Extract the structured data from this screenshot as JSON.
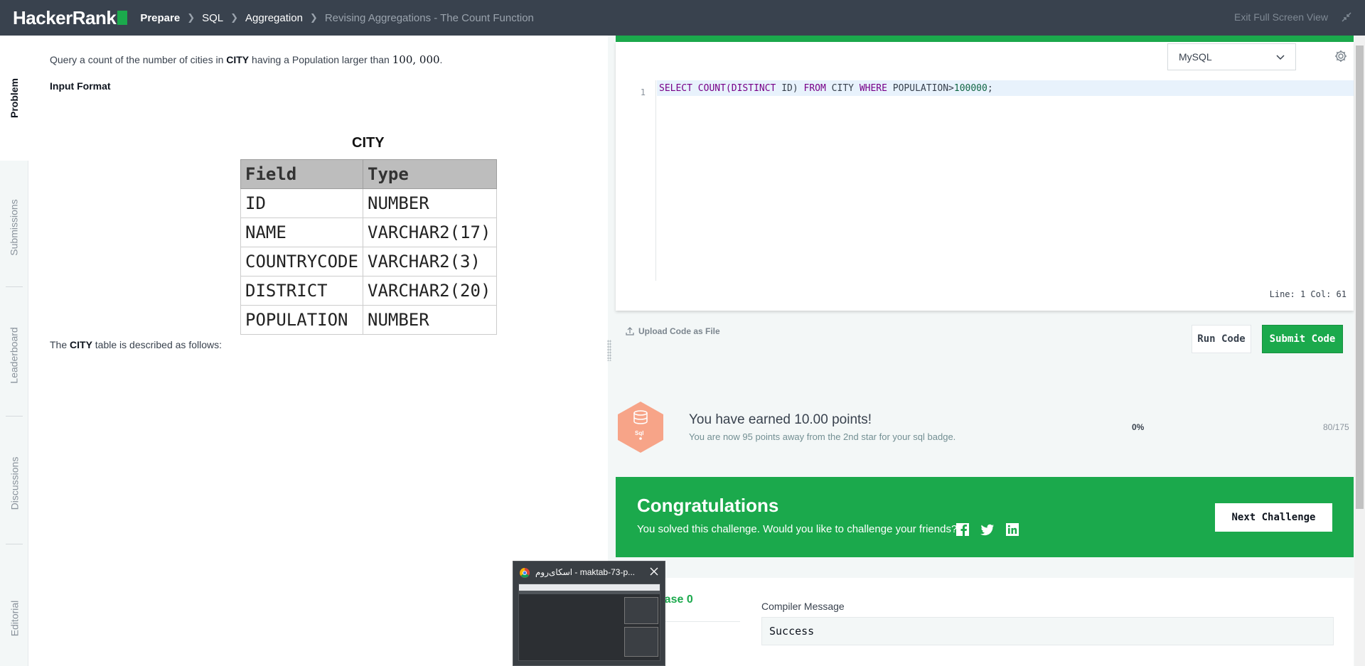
{
  "nav": {
    "logo_text": "HackerRank",
    "breadcrumbs": [
      "Prepare",
      "SQL",
      "Aggregation",
      "Revising Aggregations - The Count Function"
    ],
    "exit_label": "Exit Full Screen View"
  },
  "side_tabs": [
    "Problem",
    "Submissions",
    "Leaderboard",
    "Discussions",
    "Editorial"
  ],
  "problem": {
    "statement_pre": "Query a count of the number of cities in ",
    "statement_bold": "CITY",
    "statement_mid": " having a Population larger than ",
    "statement_math": "100, 000",
    "statement_end": ".",
    "input_format_label": "Input Format",
    "table_title": "CITY",
    "table_headers": [
      "Field",
      "Type"
    ],
    "table_rows": [
      [
        "ID",
        "NUMBER"
      ],
      [
        "NAME",
        "VARCHAR2(17)"
      ],
      [
        "COUNTRYCODE",
        "VARCHAR2(3)"
      ],
      [
        "DISTRICT",
        "VARCHAR2(20)"
      ],
      [
        "POPULATION",
        "NUMBER"
      ]
    ],
    "describe_pre": "The ",
    "describe_bold": "CITY",
    "describe_post": " table is described as follows:"
  },
  "editor": {
    "language": "MySQL",
    "line_number": "1",
    "code_tokens": {
      "select": "SELECT",
      "count": " COUNT(",
      "distinct": "DISTINCT",
      "id": " ID) ",
      "from": "FROM",
      "city": " CITY ",
      "where": "WHERE",
      "population": " POPULATION>",
      "value": "100000",
      "semi": ";"
    },
    "status": "Line: 1 Col: 61",
    "upload_label": "Upload Code as File",
    "run_label": "Run Code",
    "submit_label": "Submit Code"
  },
  "points": {
    "badge_label": "Sql",
    "earned_text": "You have earned 10.00 points!",
    "away_text": "You are now 95 points away from the 2nd star for your sql badge.",
    "percent": "0%",
    "progress": "80/175",
    "badge_color": "#f7a488"
  },
  "congrats": {
    "title": "Congratulations",
    "message": "You solved this challenge. Would you like to challenge your friends?",
    "next_label": "Next Challenge",
    "color": "#1ba94c"
  },
  "results": {
    "testcase_label": "t case 0",
    "compiler_label": "Compiler Message",
    "compiler_value": "Success"
  },
  "taskbar_preview": {
    "title": "اسکای‌روم - maktab-73-p..."
  }
}
